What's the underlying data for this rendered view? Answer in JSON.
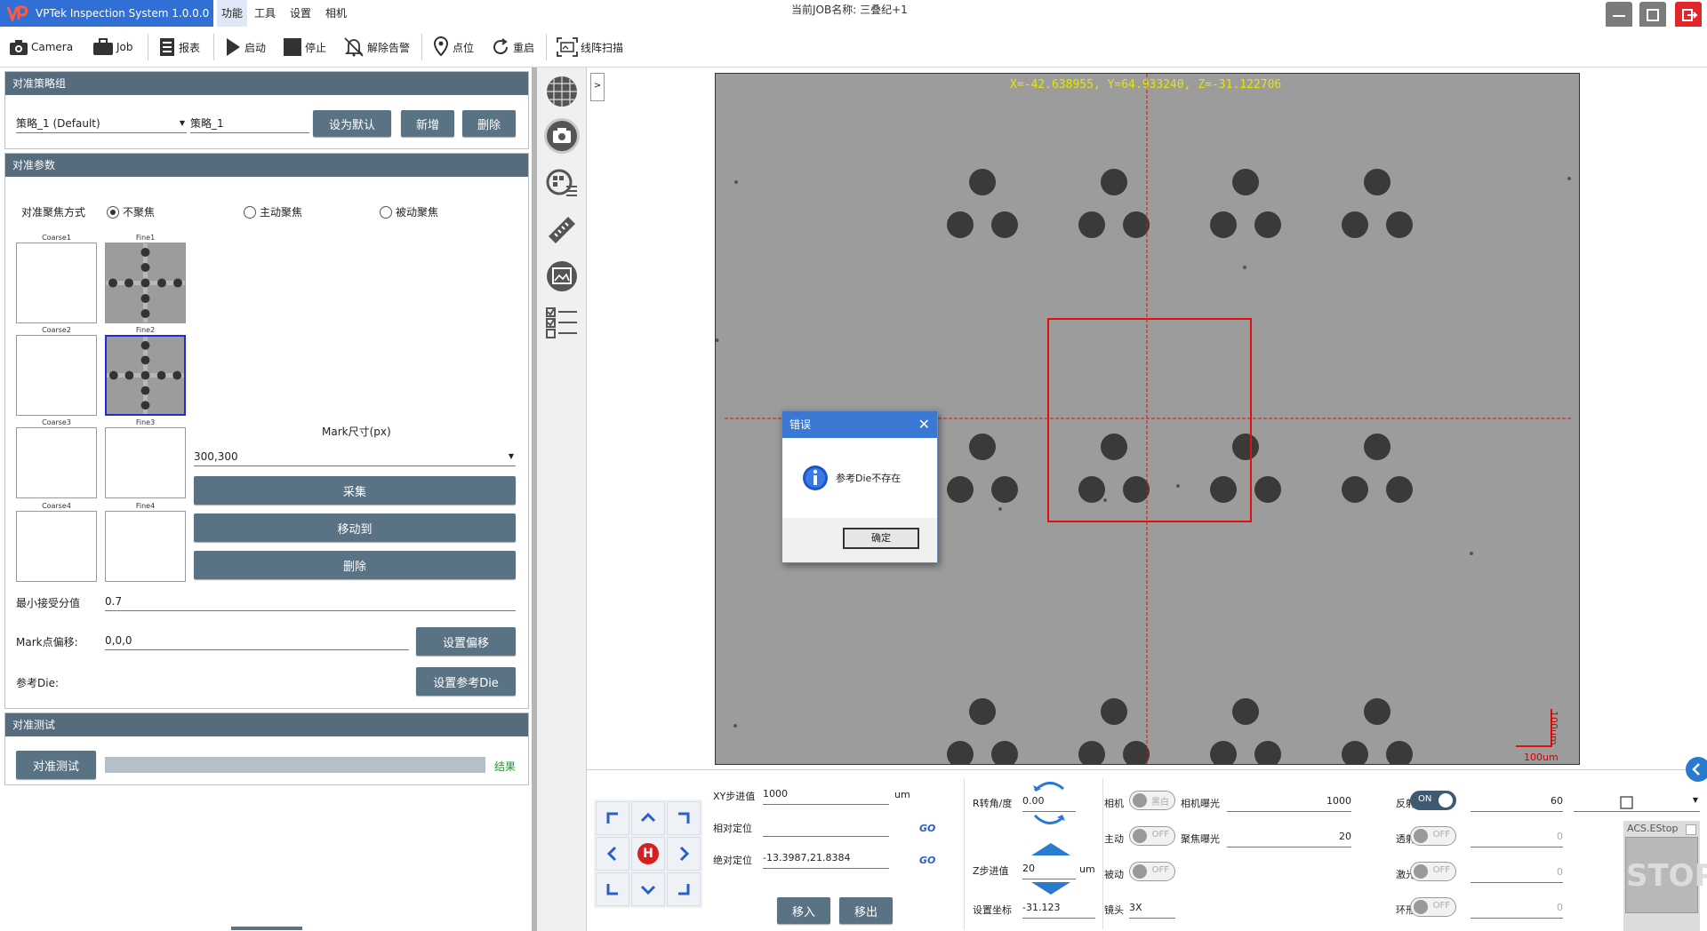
{
  "app": {
    "title": "VPTek Inspection System 1.0.0.0"
  },
  "menu": [
    {
      "label": "功能"
    },
    {
      "label": "工具"
    },
    {
      "label": "设置"
    },
    {
      "label": "相机"
    }
  ],
  "job_name": "当前JOB名称: 三叠纪+1",
  "toolbar": {
    "camera": "Camera",
    "job": "Job",
    "report": "报表",
    "start": "启动",
    "stop": "停止",
    "clear_alarm": "解除告警",
    "point": "点位",
    "restart": "重启",
    "line_scan": "线阵扫描"
  },
  "strategy": {
    "header": "对准策略组",
    "selected": "策略_1 (Default)",
    "name": "策略_1",
    "set_default": "设为默认",
    "add": "新增",
    "delete": "删除"
  },
  "params": {
    "header": "对准参数",
    "focus_label": "对准聚焦方式",
    "focus_options": [
      "不聚焦",
      "主动聚焦",
      "被动聚焦"
    ],
    "focus_selected": "不聚焦",
    "thumbs": [
      {
        "coarse": "Coarse1",
        "fine": "Fine1"
      },
      {
        "coarse": "Coarse2",
        "fine": "Fine2"
      },
      {
        "coarse": "Coarse3",
        "fine": "Fine3"
      },
      {
        "coarse": "Coarse4",
        "fine": "Fine4"
      }
    ],
    "mark_size_label": "Mark尺寸(px)",
    "mark_size": "300,300",
    "collect": "采集",
    "move_to": "移动到",
    "delete": "删除",
    "min_score_label": "最小接受分值",
    "min_score": "0.7",
    "offset_label": "Mark点偏移:",
    "offset": "0,0,0",
    "set_offset": "设置偏移",
    "ref_die_label": "参考Die:",
    "set_ref_die": "设置参考Die"
  },
  "test": {
    "header": "对准测试",
    "button": "对准测试",
    "result": "结果"
  },
  "viewer": {
    "coords": "X=-42.638955, Y=64.933240, Z=-31.122706",
    "scale_h": "100um",
    "scale_v": "100um",
    "expand": ">"
  },
  "dialog": {
    "title": "错误",
    "message": "参考Die不存在",
    "ok": "确定"
  },
  "stage": {
    "xy_step_label": "XY步进值",
    "xy_step": "1000",
    "xy_unit": "um",
    "rel_pos_label": "相对定位",
    "rel_pos": "",
    "abs_pos_label": "绝对定位",
    "abs_pos": "-13.3987,21.8384",
    "go": "GO",
    "move_in": "移入",
    "move_out": "移出",
    "r_angle_label": "R转角/度",
    "r_angle": "0.00",
    "z_step_label": "Z步进值",
    "z_step": "20",
    "z_unit": "um",
    "set_coord_label": "设置坐标",
    "set_coord": "-31.123",
    "home": "H"
  },
  "camera_ctrl": {
    "camera_label": "相机",
    "camera_toggle": "黑白",
    "exposure_label": "相机曝光",
    "exposure": "1000",
    "active_label": "主动",
    "focus_exposure_label": "聚焦曝光",
    "focus_exposure": "20",
    "passive_label": "被动",
    "lens_label": "镜头",
    "lens": "3X",
    "off": "OFF",
    "on": "ON"
  },
  "lights": [
    {
      "label": "反射",
      "state": "ON",
      "value": "60"
    },
    {
      "label": "透射",
      "state": "OFF",
      "value": "0"
    },
    {
      "label": "激光",
      "state": "OFF",
      "value": "0"
    },
    {
      "label": "环形",
      "state": "OFF",
      "value": "0"
    }
  ],
  "estop": {
    "label": "ACS.EStop",
    "stop": "STOP"
  },
  "colors": {
    "accent": "#2f6fd6",
    "panel_header": "#566b7c",
    "button": "#5a7384",
    "close_red": "#e0262b"
  }
}
